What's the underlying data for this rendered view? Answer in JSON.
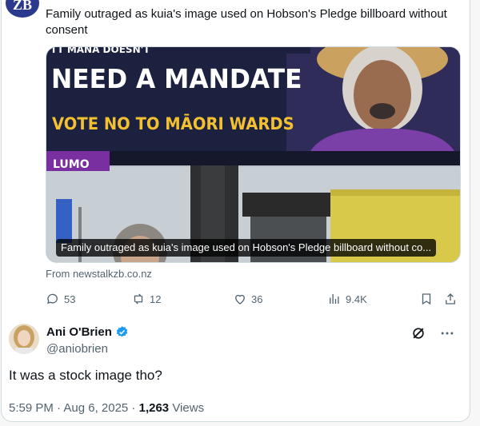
{
  "quoted": {
    "avatar_text": "ZB",
    "text": "Family outraged as kuia's image used on Hobson's Pledge billboard without consent",
    "billboard": {
      "line1": "NEED A MANDATE",
      "line2": "VOTE NO TO MĀORI WARDS",
      "lumo": "LUMO"
    },
    "card_caption": "Family outraged as kuia's image used on Hobson's Pledge billboard without co...",
    "source": "From newstalkzb.co.nz",
    "actions": {
      "replies": "53",
      "reposts": "12",
      "likes": "36",
      "views": "9.4K"
    }
  },
  "reply": {
    "name": "Ani O'Brien",
    "handle": "@aniobrien",
    "text": "It was a stock image tho?",
    "timestamp": "5:59 PM · Aug 6, 2025 · ",
    "views_count": "1,263",
    "views_label": " Views"
  },
  "colors": {
    "verified": "#1d9bf0",
    "billboard_bg": "#1c2140",
    "billboard_yellow": "#f2c030",
    "muted_text": "#536471"
  }
}
